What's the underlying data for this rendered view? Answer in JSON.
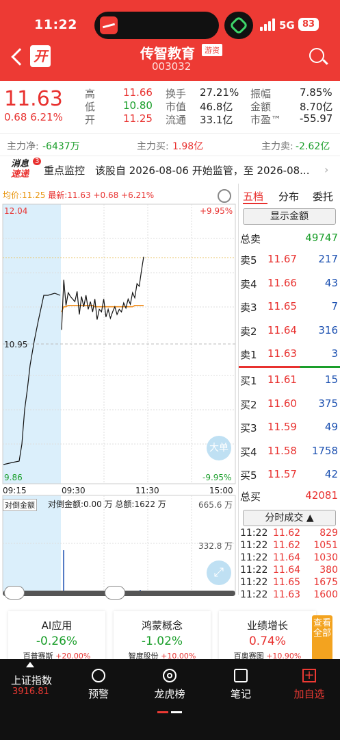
{
  "status_bar": {
    "time": "11:22",
    "network": "5G",
    "battery": "83"
  },
  "header": {
    "badge": "开",
    "title": "传智教育",
    "tag": "游资",
    "code": "003032"
  },
  "quote": {
    "price": "11.63",
    "change": "0.68",
    "change_pct": "6.21%",
    "stats": [
      {
        "label": "高",
        "value": "11.66",
        "color": "red"
      },
      {
        "label": "换手",
        "value": "27.21%",
        "color": "black"
      },
      {
        "label": "振幅",
        "value": "7.85%",
        "color": "black"
      },
      {
        "label": "低",
        "value": "10.80",
        "color": "green"
      },
      {
        "label": "市值",
        "value": "46.8亿",
        "color": "black"
      },
      {
        "label": "金额",
        "value": "8.70亿",
        "color": "black"
      },
      {
        "label": "开",
        "value": "11.25",
        "color": "red"
      },
      {
        "label": "流通",
        "value": "33.1亿",
        "color": "black"
      },
      {
        "label": "市盈™",
        "value": "-55.97",
        "color": "black"
      }
    ]
  },
  "flow": {
    "net_label": "主力净:",
    "net_value": "-6437万",
    "buy_label": "主力买:",
    "buy_value": "1.98亿",
    "sell_label": "主力卖:",
    "sell_value": "-2.62亿"
  },
  "news": {
    "logo_top": "消息",
    "logo_bottom": "速递",
    "count": "3",
    "text": "重点监控　该股自 2026-08-06 开始监管，至 2026-08..."
  },
  "chart": {
    "legend_avg": "均价:11.25",
    "legend_last": "最新:11.63 +0.68 +6.21%",
    "y_top": "12.04",
    "y_mid": "10.95",
    "y_bottom": "9.86",
    "pct_top": "+9.95%",
    "pct_bottom": "-9.95%",
    "times": [
      "09:15",
      "09:30",
      "11:30",
      "15:00"
    ],
    "big_order": "大单",
    "vol_selector": "对倒金额",
    "vol_info": "对倒金额:0.00 万 总额:1622 万",
    "vol_top": "665.6 万",
    "vol_mid": "332.8 万"
  },
  "chart_data": {
    "type": "line",
    "ylim": [
      9.86,
      12.04
    ],
    "prev_close": 10.95,
    "price": [
      11.06,
      11.45,
      11.25,
      11.35,
      11.32,
      11.3,
      11.28,
      11.36,
      11.18,
      11.32,
      11.24,
      11.33,
      11.22,
      11.28,
      11.2,
      11.3,
      11.14,
      11.22,
      11.2,
      11.3,
      11.16,
      11.22,
      11.15,
      11.2,
      11.24,
      11.18,
      11.22,
      11.2,
      11.27,
      11.23,
      11.3,
      11.26,
      11.35,
      11.31,
      11.42,
      11.4,
      11.52,
      11.63
    ],
    "avg": [
      11.2,
      11.24,
      11.24,
      11.25,
      11.25,
      11.25,
      11.25,
      11.25,
      11.25,
      11.25,
      11.25,
      11.25,
      11.25,
      11.25,
      11.25,
      11.24,
      11.24,
      11.24,
      11.24,
      11.24,
      11.24,
      11.24,
      11.24,
      11.24,
      11.24,
      11.24,
      11.24,
      11.24,
      11.24,
      11.24,
      11.24,
      11.24,
      11.24,
      11.25,
      11.25,
      11.25,
      11.25,
      11.25
    ]
  },
  "orderbook": {
    "tabs": [
      "五档",
      "分布",
      "委托"
    ],
    "show_amount": "显示金额",
    "total_sell_label": "总卖",
    "total_sell": "49747",
    "asks": [
      {
        "label": "卖5",
        "price": "11.67",
        "vol": "217"
      },
      {
        "label": "卖4",
        "price": "11.66",
        "vol": "43"
      },
      {
        "label": "卖3",
        "price": "11.65",
        "vol": "7"
      },
      {
        "label": "卖2",
        "price": "11.64",
        "vol": "316"
      },
      {
        "label": "卖1",
        "price": "11.63",
        "vol": "3"
      }
    ],
    "bids": [
      {
        "label": "买1",
        "price": "11.61",
        "vol": "15"
      },
      {
        "label": "买2",
        "price": "11.60",
        "vol": "375"
      },
      {
        "label": "买3",
        "price": "11.59",
        "vol": "49"
      },
      {
        "label": "买4",
        "price": "11.58",
        "vol": "1758"
      },
      {
        "label": "买5",
        "price": "11.57",
        "vol": "42"
      }
    ],
    "total_buy_label": "总买",
    "total_buy": "42081",
    "ticks_label": "分时成交 ▲",
    "ticks": [
      {
        "time": "11:22",
        "price": "11.62",
        "vol": "829"
      },
      {
        "time": "11:22",
        "price": "11.62",
        "vol": "1051"
      },
      {
        "time": "11:22",
        "price": "11.64",
        "vol": "1030"
      },
      {
        "time": "11:22",
        "price": "11.64",
        "vol": "380"
      },
      {
        "time": "11:22",
        "price": "11.65",
        "vol": "1675"
      },
      {
        "time": "11:22",
        "price": "11.63",
        "vol": "1600"
      }
    ]
  },
  "sectors": [
    {
      "name": "AI应用",
      "pct": "-0.26%",
      "lead": "百普赛斯",
      "lead_pct": "+20.00%"
    },
    {
      "name": "鸿蒙概念",
      "pct": "-1.02%",
      "lead": "智度股份",
      "lead_pct": "+10.00%"
    },
    {
      "name": "业绩增长",
      "pct": "0.74%",
      "lead": "百奥赛图",
      "lead_pct": "+10.90%"
    }
  ],
  "view_all": "查看全部",
  "tabbar": {
    "index_name": "上证指数",
    "index_value": "3916.81",
    "items": [
      "预警",
      "龙虎榜",
      "笔记",
      "加自选"
    ]
  }
}
